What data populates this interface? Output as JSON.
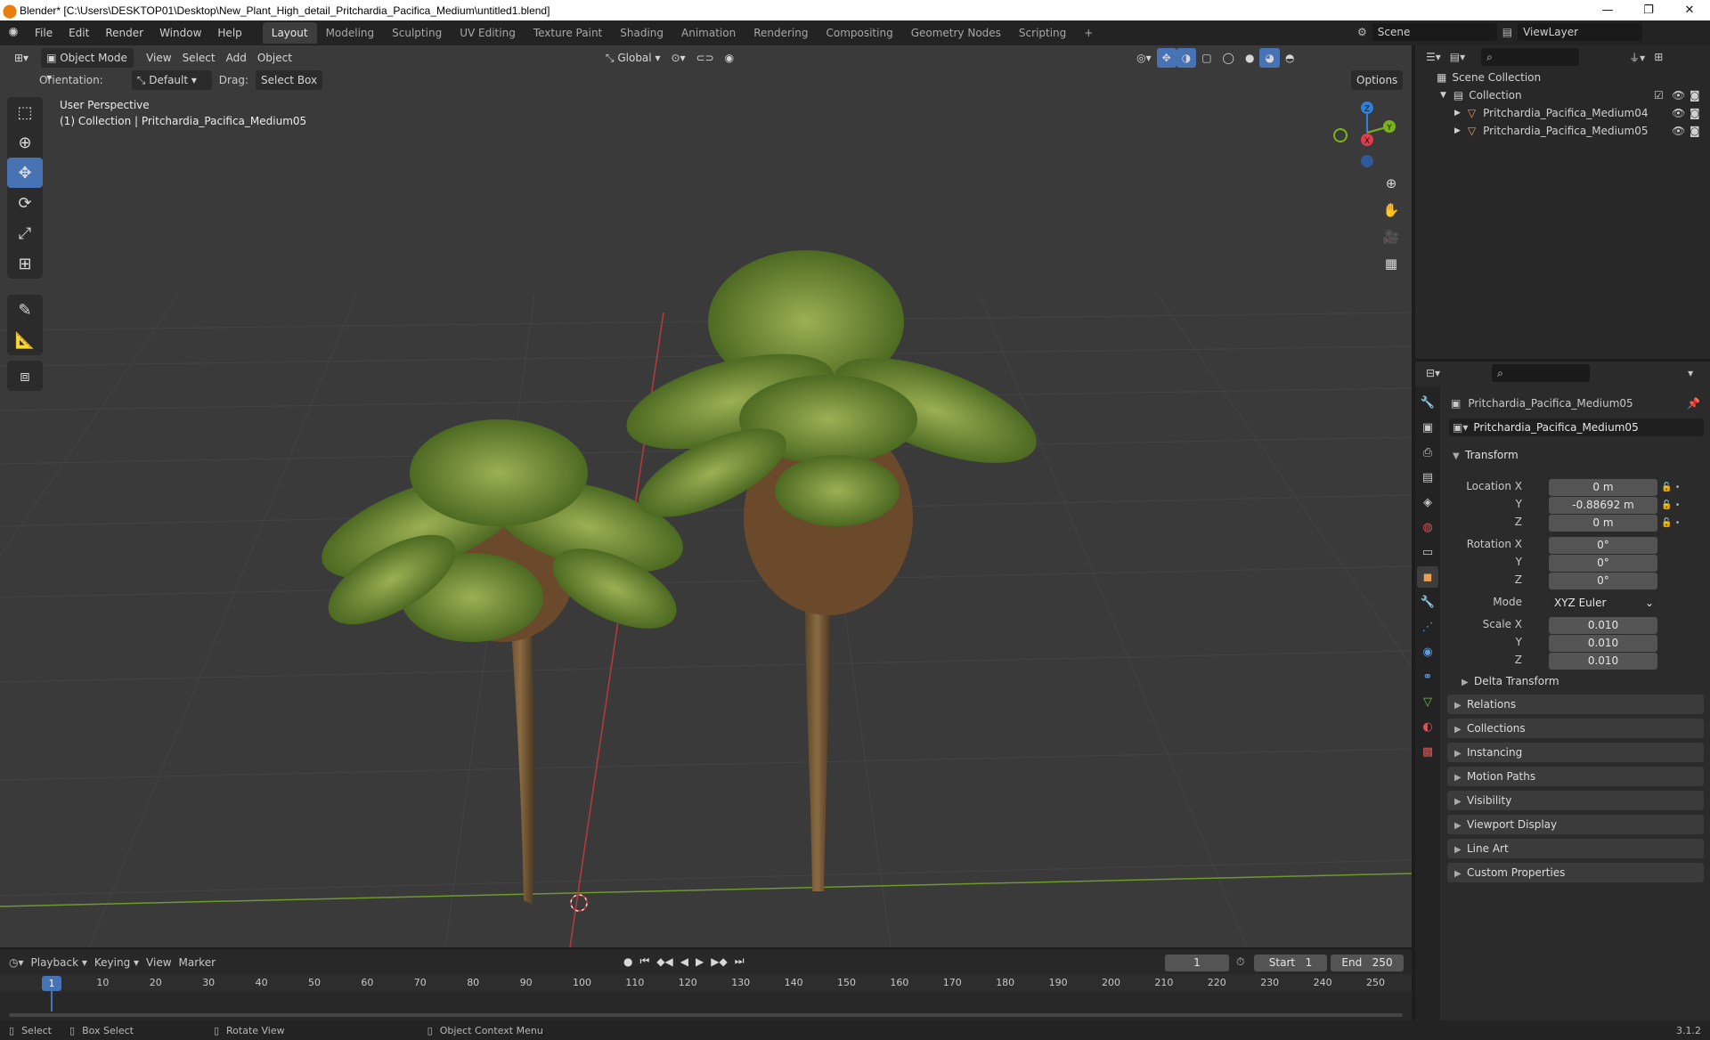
{
  "window": {
    "title": "Blender* [C:\\Users\\DESKTOP01\\Desktop\\New_Plant_High_detail_Pritchardia_Pacifica_Medium\\untitled1.blend]",
    "controls": [
      "—",
      "❐",
      "✕"
    ]
  },
  "menu": [
    "File",
    "Edit",
    "Render",
    "Window",
    "Help"
  ],
  "workspaces": [
    {
      "label": "Layout",
      "active": true
    },
    {
      "label": "Modeling"
    },
    {
      "label": "Sculpting"
    },
    {
      "label": "UV Editing"
    },
    {
      "label": "Texture Paint"
    },
    {
      "label": "Shading"
    },
    {
      "label": "Animation"
    },
    {
      "label": "Rendering"
    },
    {
      "label": "Compositing"
    },
    {
      "label": "Geometry Nodes"
    },
    {
      "label": "Scripting"
    }
  ],
  "add_workspace": "+",
  "scene": {
    "name": "Scene",
    "view_layer": "ViewLayer"
  },
  "viewport": {
    "mode": "Object Mode",
    "menus": [
      "View",
      "Select",
      "Add",
      "Object"
    ],
    "transform_orientation": "Global",
    "options_label": "Options",
    "orientation_label": "Orientation:",
    "orientation_value": "Default",
    "drag_label": "Drag:",
    "drag_value": "Select Box",
    "overlay_line1": "User Perspective",
    "overlay_line2": "(1) Collection | Pritchardia_Pacifica_Medium05",
    "gizmo": {
      "x": "X",
      "y": "Y",
      "z": "Z"
    }
  },
  "outliner": {
    "root": "Scene Collection",
    "collection": "Collection",
    "items": [
      "Pritchardia_Pacifica_Medium04",
      "Pritchardia_Pacifica_Medium05"
    ]
  },
  "properties": {
    "object_name": "Pritchardia_Pacifica_Medium05",
    "object_field": "Pritchardia_Pacifica_Medium05",
    "transform_title": "Transform",
    "location": {
      "label_x": "Location X",
      "x": "0 m",
      "y": "-0.88692 m",
      "z": "0 m"
    },
    "rotation": {
      "label_x": "Rotation X",
      "x": "0°",
      "y": "0°",
      "z": "0°"
    },
    "mode_label": "Mode",
    "mode_value": "XYZ Euler",
    "scale": {
      "label_x": "Scale X",
      "x": "0.010",
      "y": "0.010",
      "z": "0.010"
    },
    "axis_y": "Y",
    "axis_z": "Z",
    "delta_transform": "Delta Transform",
    "panels": [
      "Relations",
      "Collections",
      "Instancing",
      "Motion Paths",
      "Visibility",
      "Viewport Display",
      "Line Art",
      "Custom Properties"
    ]
  },
  "timeline": {
    "menus": [
      "Playback",
      "Keying",
      "View",
      "Marker"
    ],
    "current_frame": "1",
    "start_label": "Start",
    "start": "1",
    "end_label": "End",
    "end": "250",
    "ruler": [
      "10",
      "20",
      "30",
      "40",
      "50",
      "60",
      "70",
      "80",
      "90",
      "100",
      "110",
      "120",
      "130",
      "140",
      "150",
      "160",
      "170",
      "180",
      "190",
      "200",
      "210",
      "220",
      "230",
      "240",
      "250"
    ],
    "playhead": "1"
  },
  "statusbar": {
    "items": [
      "Select",
      "Box Select",
      "Rotate View",
      "Object Context Menu"
    ],
    "version": "3.1.2"
  },
  "colors": {
    "accent": "#4772b3",
    "x_axis": "#e23b4b",
    "y_axis": "#7ab317",
    "z_axis": "#2f7fdc"
  }
}
